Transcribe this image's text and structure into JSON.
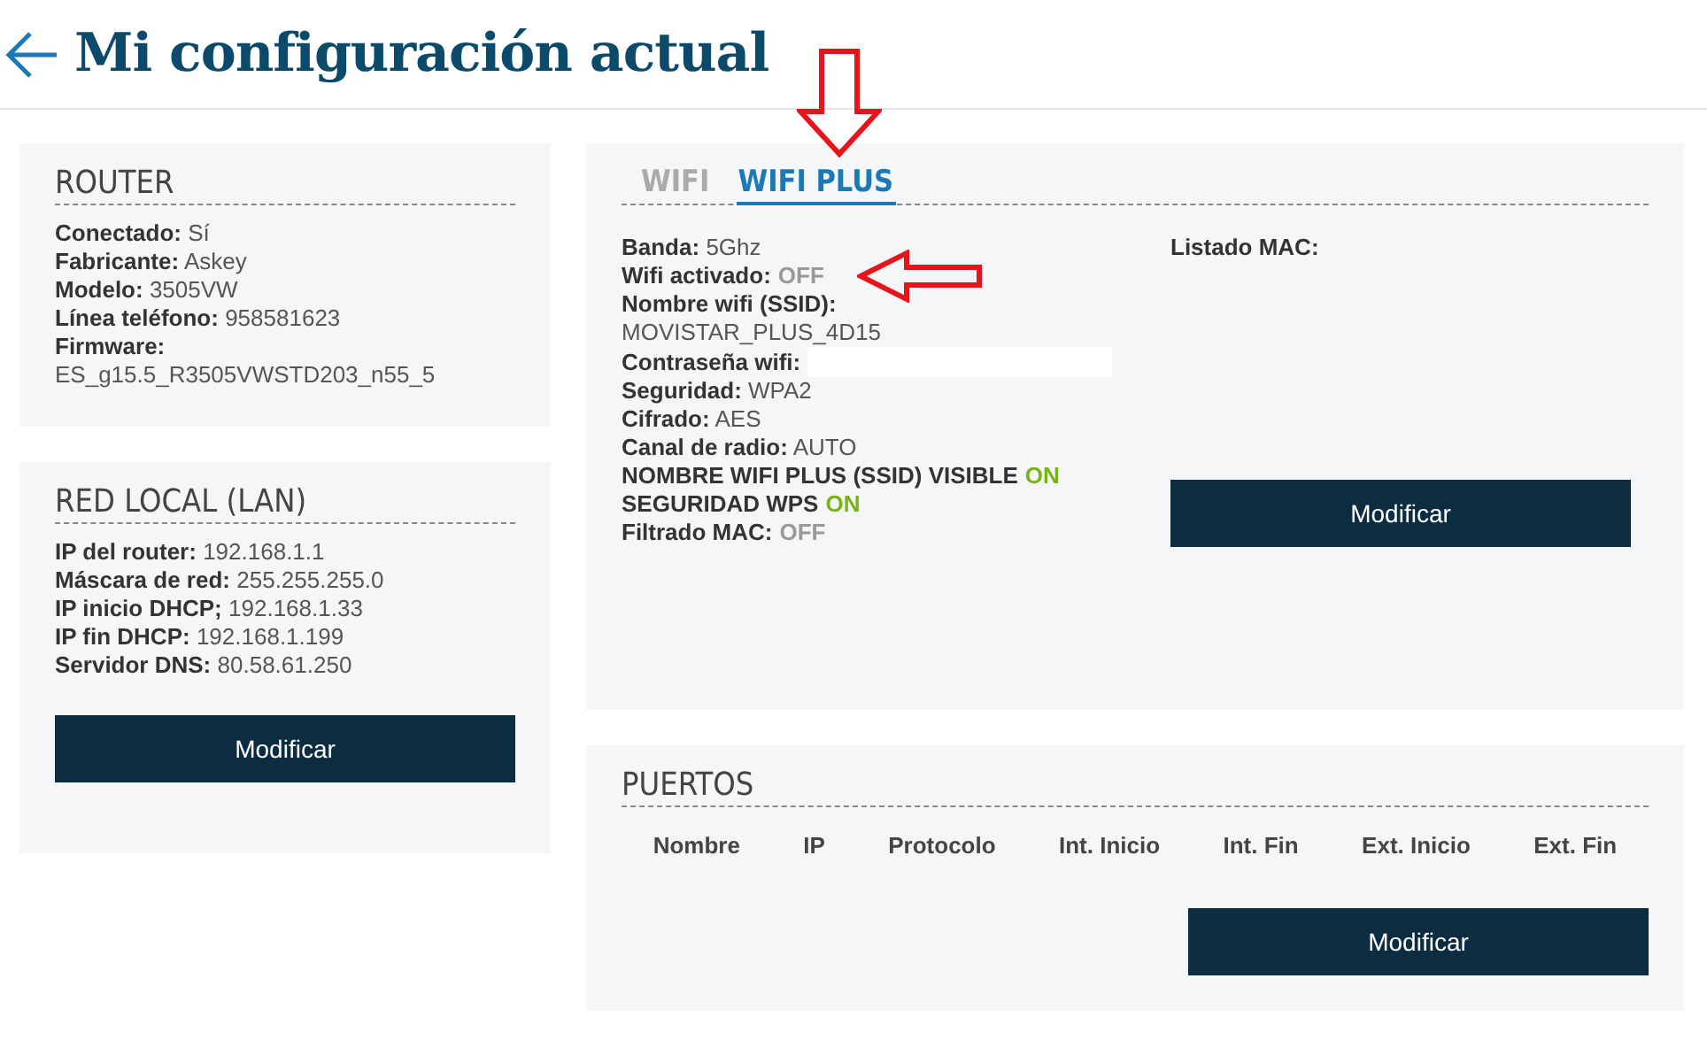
{
  "header": {
    "title": "Mi configuración actual"
  },
  "router": {
    "title": "ROUTER",
    "fields": [
      {
        "label": "Conectado:",
        "value": "Sí",
        "kind": "inline"
      },
      {
        "label": "Fabricante:",
        "value": "Askey",
        "kind": "inline"
      },
      {
        "label": "Modelo:",
        "value": "3505VW",
        "kind": "inline"
      },
      {
        "label": "Línea teléfono:",
        "value": "958581623",
        "kind": "inline"
      },
      {
        "label": "Firmware:",
        "value": "ES_g15.5_R3505VWSTD203_n55_5",
        "kind": "block"
      }
    ]
  },
  "lan": {
    "title": "RED LOCAL (LAN)",
    "fields": [
      {
        "label": "IP del router:",
        "value": "192.168.1.1",
        "kind": "inline"
      },
      {
        "label": "Máscara de red:",
        "value": "255.255.255.0",
        "kind": "inline"
      },
      {
        "label": "IP inicio DHCP;",
        "value": "192.168.1.33",
        "kind": "inline"
      },
      {
        "label": "IP fin DHCP:",
        "value": "192.168.1.199",
        "kind": "inline"
      },
      {
        "label": "Servidor DNS:",
        "value": "80.58.61.250",
        "kind": "inline"
      }
    ],
    "button": "Modificar"
  },
  "wifi": {
    "tabs": [
      {
        "label": "WIFI",
        "selected": false
      },
      {
        "label": "WIFI PLUS",
        "selected": true
      }
    ],
    "fields": [
      {
        "label": "Banda:",
        "value": "5Ghz",
        "kind": "inline"
      },
      {
        "label": "Wifi activado:",
        "value": "OFF",
        "kind": "toggle",
        "on": false
      },
      {
        "label": "Nombre wifi (SSID):",
        "value": "MOVISTAR_PLUS_4D15",
        "kind": "block"
      },
      {
        "label": "Contraseña wifi:",
        "kind": "redacted"
      },
      {
        "label": "Seguridad:",
        "value": "WPA2",
        "kind": "inline"
      },
      {
        "label": "Cifrado:",
        "value": "AES",
        "kind": "inline"
      },
      {
        "label": "Canal de radio:",
        "value": "AUTO",
        "kind": "inline"
      },
      {
        "label": "NOMBRE WIFI PLUS (SSID) VISIBLE",
        "value": "ON",
        "kind": "toggle",
        "on": true
      },
      {
        "label": "SEGURIDAD WPS",
        "value": "ON",
        "kind": "toggle",
        "on": true
      },
      {
        "label": "Filtrado MAC:",
        "value": "OFF",
        "kind": "toggle",
        "on": false
      }
    ],
    "mac_label": "Listado MAC:",
    "button": "Modificar"
  },
  "ports": {
    "title": "PUERTOS",
    "columns": [
      "Nombre",
      "IP",
      "Protocolo",
      "Int. Inicio",
      "Int. Fin",
      "Ext. Inicio",
      "Ext. Fin"
    ],
    "button": "Modificar"
  }
}
